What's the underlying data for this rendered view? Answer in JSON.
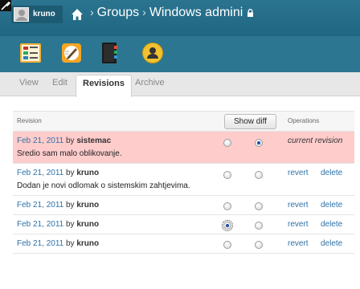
{
  "header": {
    "user_name": "kruno",
    "breadcrumb_groups": "Groups",
    "breadcrumb_current": "Windows admini",
    "separator": "›"
  },
  "icons": {
    "wrench": "wrench-icon",
    "home": "home-icon",
    "lock": "lock-icon",
    "apps": [
      "calendar-board-icon",
      "notes-pen-icon",
      "notebook-icon",
      "member-profile-icon"
    ]
  },
  "tabs": [
    {
      "label": "View",
      "active": false
    },
    {
      "label": "Edit",
      "active": false
    },
    {
      "label": "Revisions",
      "active": true
    },
    {
      "label": "Archive",
      "active": false
    }
  ],
  "table": {
    "col_revision": "Revision",
    "show_diff": "Show diff",
    "col_operations": "Operations",
    "rows": [
      {
        "date": "Feb 21, 2011",
        "by": "by",
        "user": "sistemac",
        "message": "Sredio sam malo oblikovanje.",
        "current": true,
        "radio_left": false,
        "radio_right": true,
        "operation": "current revision"
      },
      {
        "date": "Feb 21, 2011",
        "by": "by",
        "user": "kruno",
        "message": "Dodan je novi odlomak o sistemskim zahtjevima.",
        "current": false,
        "radio_left": false,
        "radio_right": false,
        "revert": "revert",
        "delete": "delete"
      },
      {
        "date": "Feb 21, 2011",
        "by": "by",
        "user": "kruno",
        "message": "",
        "current": false,
        "radio_left": false,
        "radio_right": false,
        "revert": "revert",
        "delete": "delete"
      },
      {
        "date": "Feb 21, 2011",
        "by": "by",
        "user": "kruno",
        "message": "",
        "current": false,
        "radio_left": true,
        "radio_right": false,
        "revert": "revert",
        "delete": "delete"
      },
      {
        "date": "Feb 21, 2011",
        "by": "by",
        "user": "kruno",
        "message": "",
        "current": false,
        "radio_left": false,
        "radio_right": false,
        "revert": "revert",
        "delete": "delete"
      }
    ]
  },
  "colors": {
    "header": "#1f6682",
    "current_row": "#ffcccc",
    "link": "#2e72a8"
  }
}
